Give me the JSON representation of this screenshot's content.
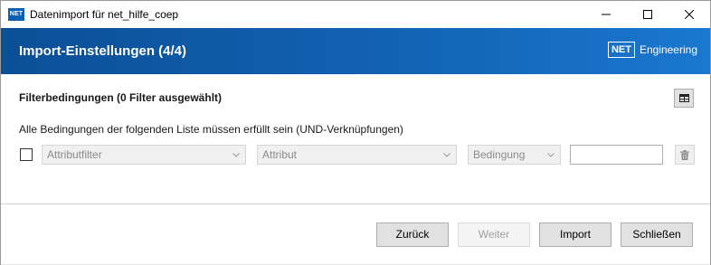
{
  "window": {
    "title": "Datenimport für net_hilfe_coep",
    "app_icon_text": "NET"
  },
  "header": {
    "title": "Import-Einstellungen (4/4)",
    "brand_box": "NET",
    "brand_text": "Engineering"
  },
  "filter": {
    "section_title": "Filterbedingungen (0 Filter ausgewählt)",
    "description": "Alle Bedingungen der folgenden Liste müssen erfüllt sein (UND-Verknüpfungen)",
    "row": {
      "checked": false,
      "attribute_filter": "Attributfilter",
      "attribute": "Attribut",
      "condition": "Bedingung",
      "value": ""
    }
  },
  "buttons": {
    "back": "Zurück",
    "next": "Weiter",
    "import": "Import",
    "close": "Schließen"
  },
  "colors": {
    "header_start": "#0b4f96",
    "header_end": "#1a78cf",
    "button_face": "#e1e1e1"
  },
  "icons": [
    "app-icon",
    "minimize-icon",
    "maximize-icon",
    "close-icon",
    "table-icon",
    "chevron-down-icon",
    "trash-icon"
  ]
}
